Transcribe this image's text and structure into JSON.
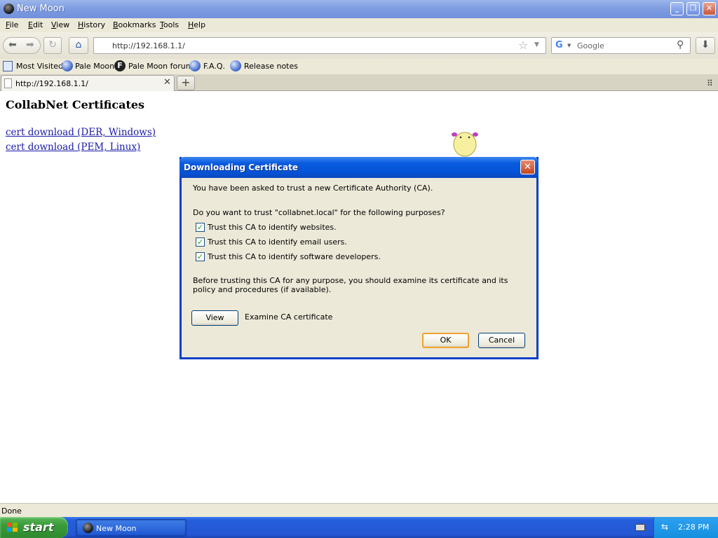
{
  "window": {
    "title": "New Moon",
    "controls": {
      "minimize": "_",
      "maximize": "❐",
      "close": "✕"
    }
  },
  "menu": [
    {
      "label": "File",
      "accel": "F",
      "rest": "ile"
    },
    {
      "label": "Edit",
      "accel": "E",
      "rest": "dit"
    },
    {
      "label": "View",
      "accel": "V",
      "rest": "iew"
    },
    {
      "label": "History",
      "accel": "H",
      "rest": "istory"
    },
    {
      "label": "Bookmarks",
      "accel": "B",
      "rest": "ookmarks"
    },
    {
      "label": "Tools",
      "accel": "T",
      "rest": "ools"
    },
    {
      "label": "Help",
      "accel": "H",
      "rest": "elp"
    }
  ],
  "nav": {
    "url": "http://192.168.1.1/",
    "search_placeholder": "Google"
  },
  "bookmarks": [
    {
      "label": "Most Visited",
      "icon": "most-visited-icon"
    },
    {
      "label": "Pale Moon",
      "icon": "pale-moon-globe-icon"
    },
    {
      "label": "Pale Moon forum",
      "icon": "forum-f-icon"
    },
    {
      "label": "F.A.Q.",
      "icon": "faq-globe-icon"
    },
    {
      "label": "Release notes",
      "icon": "release-notes-globe-icon"
    }
  ],
  "tabs": [
    {
      "label": "http://192.168.1.1/",
      "active": true
    }
  ],
  "page": {
    "heading": "CollabNet Certificates",
    "links": [
      "cert download (DER, Windows)",
      "cert download (PEM, Linux)"
    ]
  },
  "dialog": {
    "title": "Downloading Certificate",
    "intro": "You have been asked to trust a new Certificate Authority (CA).",
    "question": "Do you want to trust \"collabnet.local\" for the following purposes?",
    "options": [
      {
        "label": "Trust this CA to identify websites.",
        "checked": true
      },
      {
        "label": "Trust this CA to identify email users.",
        "checked": true
      },
      {
        "label": "Trust this CA to identify software developers.",
        "checked": true
      }
    ],
    "advice": "Before trusting this CA for any purpose, you should examine its certificate and its policy and procedures (if available).",
    "view_button": "View",
    "view_caption": "Examine CA certificate",
    "ok_button": "OK",
    "cancel_button": "Cancel"
  },
  "status": "Done",
  "taskbar": {
    "start": "start",
    "task": "New Moon",
    "clock": "2:28 PM"
  }
}
